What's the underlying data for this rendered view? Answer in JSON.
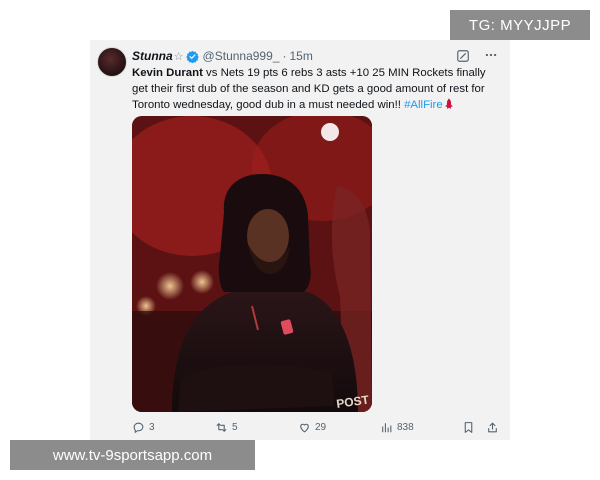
{
  "watermarks": {
    "top": "TG: MYYJJPP",
    "bottom": "www.tv-9sportsapp.com"
  },
  "tweet": {
    "author": {
      "display_name": "Stunna",
      "name_symbol": "☆",
      "handle": "@Stunna999_",
      "verified": true
    },
    "separator": "·",
    "timestamp": "15m",
    "body": {
      "mention": "Kevin Durant",
      "text": " vs Nets 19 pts 6 rebs 3 asts +10 25 MIN Rockets finally get their first dub of the season and KD gets a good amount of rest for Toronto wednesday, good dub in a must needed win!! ",
      "hashtag": "#AllFire",
      "emoji": "rockets-logo-icon"
    },
    "stats": {
      "replies": "3",
      "retweets": "5",
      "likes": "29",
      "views": "838"
    },
    "colors": {
      "hashtag": "#1d9bf0",
      "verified": "#1d9bf0",
      "text": "#0f1419",
      "muted": "#536471"
    }
  }
}
